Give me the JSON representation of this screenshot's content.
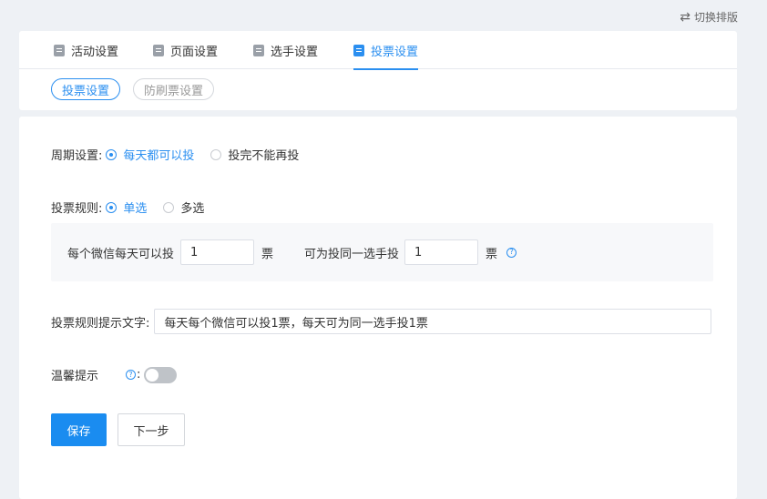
{
  "header": {
    "switch_layout_label": "切换排版",
    "switch_icon": "swap-icon"
  },
  "tabs": [
    {
      "label": "活动设置",
      "icon": "chat-icon",
      "active": false
    },
    {
      "label": "页面设置",
      "icon": "page-icon",
      "active": false
    },
    {
      "label": "选手设置",
      "icon": "player-icon",
      "active": false
    },
    {
      "label": "投票设置",
      "icon": "calendar-icon",
      "active": true
    }
  ],
  "subtabs": [
    {
      "label": "投票设置",
      "active": true
    },
    {
      "label": "防刷票设置",
      "active": false
    }
  ],
  "form": {
    "cycle": {
      "label": "周期设置:",
      "options": [
        {
          "label": "每天都可以投",
          "checked": true
        },
        {
          "label": "投完不能再投",
          "checked": false
        }
      ]
    },
    "rule": {
      "label": "投票规则:",
      "options": [
        {
          "label": "单选",
          "checked": true
        },
        {
          "label": "多选",
          "checked": false
        }
      ],
      "per_wechat_label": "每个微信每天可以投",
      "per_wechat_value": "1",
      "unit_1": "票",
      "same_player_label": "可为投同一选手投",
      "same_player_value": "1",
      "unit_2": "票"
    },
    "tip_text": {
      "label": "投票规则提示文字:",
      "value": "每天每个微信可以投1票，每天可为同一选手投1票"
    },
    "reminder": {
      "label": "温馨提示",
      "colon": ":",
      "enabled": false
    }
  },
  "buttons": {
    "save_label": "保存",
    "next_label": "下一步"
  },
  "colors": {
    "accent": "#2b8ff0",
    "primary_button": "#1a8cf0",
    "background": "#eef1f5"
  }
}
